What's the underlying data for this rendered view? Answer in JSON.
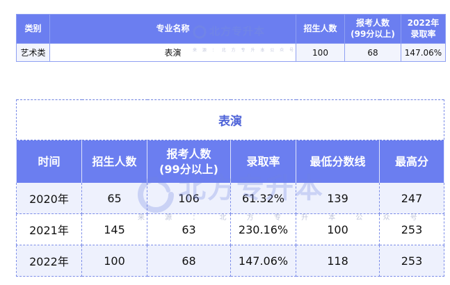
{
  "top_table": {
    "headers": {
      "category": "类别",
      "major": "专业名称",
      "enroll": "招生人数",
      "applicants_line1": "报考人数",
      "applicants_line2": "(99分以上)",
      "rate_line1": "2022年",
      "rate_line2": "录取率"
    },
    "row": {
      "category": "艺术类",
      "major": "表演",
      "enroll": "100",
      "applicants": "68",
      "rate": "147.06%"
    }
  },
  "detail_table": {
    "title": "表演",
    "headers": {
      "time": "时间",
      "enroll": "招生人数",
      "applicants_line1": "报考人数",
      "applicants_line2": "(99分以上)",
      "rate": "录取率",
      "min_score": "最低分数线",
      "max_score": "最高分"
    },
    "rows": [
      {
        "year": "2020年",
        "enroll": "65",
        "applicants": "106",
        "rate": "61.32%",
        "min": "139",
        "max": "247"
      },
      {
        "year": "2021年",
        "enroll": "145",
        "applicants": "63",
        "rate": "230.16%",
        "min": "100",
        "max": "253"
      },
      {
        "year": "2022年",
        "enroll": "100",
        "applicants": "68",
        "rate": "147.06%",
        "min": "118",
        "max": "253"
      }
    ]
  },
  "watermark": {
    "brand": "北方专升本",
    "source": "来 源 ： 北 方 专 升 本 公 众 号"
  },
  "colors": {
    "header_bg": "#6b7ef0",
    "title_text": "#4e63d8",
    "shade_row": "#eef1fd"
  }
}
